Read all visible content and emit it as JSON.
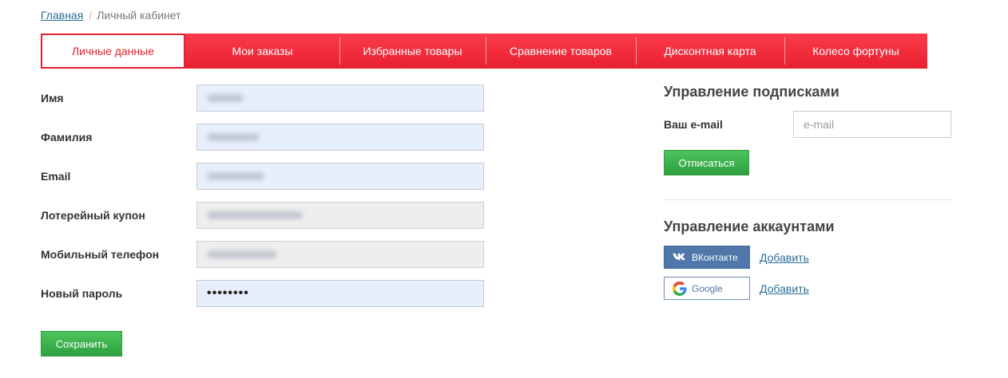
{
  "breadcrumb": {
    "home": "Главная",
    "separator": "/",
    "current": "Личный кабинет"
  },
  "tabs": [
    {
      "label": "Личные данные",
      "active": true
    },
    {
      "label": "Мои заказы"
    },
    {
      "label": "Избранные товары"
    },
    {
      "label": "Сравнение товаров"
    },
    {
      "label": "Дисконтная карта"
    },
    {
      "label": "Колесо фортуны"
    }
  ],
  "form": {
    "fields": [
      {
        "label": "Имя",
        "value_hidden": true,
        "readonly": false
      },
      {
        "label": "Фамилия",
        "value_hidden": true,
        "readonly": false
      },
      {
        "label": "Email",
        "value_hidden": true,
        "readonly": false
      },
      {
        "label": "Лотерейный купон",
        "value_hidden": true,
        "readonly": true
      },
      {
        "label": "Мобильный телефон",
        "value_hidden": true,
        "readonly": true
      },
      {
        "label": "Новый пароль",
        "value": "••••••••",
        "readonly": false
      }
    ],
    "save_label": "Сохранить"
  },
  "subscriptions": {
    "title": "Управление подписками",
    "email_label": "Ваш e-mail",
    "email_placeholder": "e-mail",
    "unsubscribe_label": "Отписаться"
  },
  "accounts": {
    "title": "Управление аккаунтами",
    "items": [
      {
        "name": "ВКонтакте",
        "icon": "vk-icon",
        "action": "Добавить"
      },
      {
        "name": "Google",
        "icon": "google-icon",
        "action": "Добавить"
      }
    ]
  },
  "colors": {
    "tab_red": "#e8202f",
    "green": "#3bb14b",
    "vk_blue": "#4f77a9",
    "link": "#2a6e95",
    "input_bg": "#e8effc"
  }
}
